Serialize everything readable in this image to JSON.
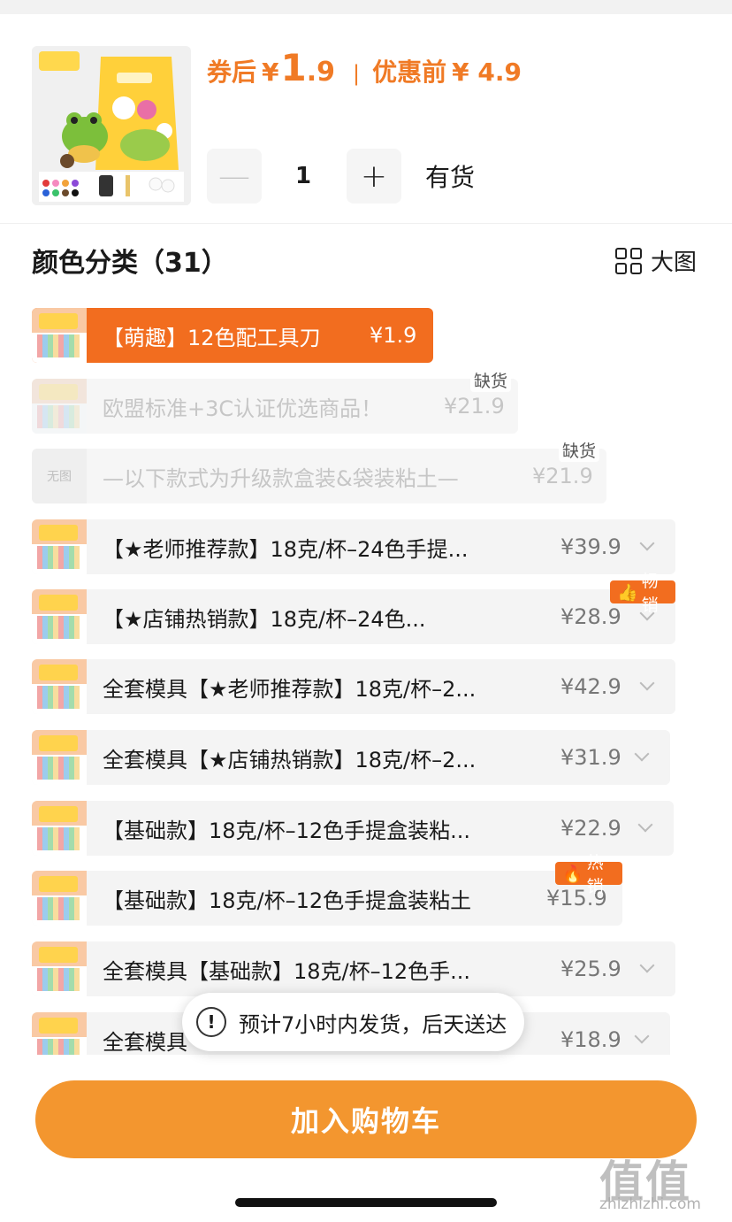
{
  "header": {
    "price_label": "券后",
    "currency": "¥",
    "price_big": "1",
    "price_small": ".9",
    "separator": "|",
    "orig_label": "优惠前",
    "orig_price": "¥ 4.9",
    "qty_minus": "—",
    "qty_plus": "+",
    "quantity": "1",
    "stock_status": "有货"
  },
  "category": {
    "title": "颜色分类（31）",
    "view_toggle": "大图"
  },
  "options": [
    {
      "name": "【萌趣】12色配工具刀",
      "price": "¥1.9",
      "state": "selected"
    },
    {
      "name": "欧盟标准+3C认证优选商品！",
      "price": "¥21.9",
      "state": "out",
      "tag": "缺货"
    },
    {
      "name": "—以下款式为升级款盒装&袋装粘土—",
      "price": "¥21.9",
      "state": "out",
      "tag": "缺货",
      "thumb_text": "无图"
    },
    {
      "name": "【★老师推荐款】18克/杯–24色手提...",
      "price": "¥39.9"
    },
    {
      "name": "【★店铺热销款】18克/杯–24色...",
      "price": "¥28.9",
      "badge": "畅销",
      "badge_icon": "thumbs-up-icon"
    },
    {
      "name": "全套模具【★老师推荐款】18克/杯–2...",
      "price": "¥42.9"
    },
    {
      "name": "全套模具【★店铺热销款】18克/杯–2...",
      "price": "¥31.9"
    },
    {
      "name": "【基础款】18克/杯–12色手提盒装粘...",
      "price": "¥22.9"
    },
    {
      "name": "【基础款】18克/杯–12色手提盒装粘土",
      "price": "¥15.9",
      "badge": "热销",
      "badge_icon": "flame-icon"
    },
    {
      "name": "全套模具【基础款】18克/杯–12色手...",
      "price": "¥25.9"
    },
    {
      "name": "全套模具",
      "price": "¥18.9"
    }
  ],
  "toast": {
    "icon": "!",
    "text": "预计7小时内发货，后天送达"
  },
  "cart_button": "加入购物车",
  "watermark": {
    "logo": "值值值",
    "url": "zhizhizhi.com"
  },
  "colors": {
    "accent": "#f26d1f",
    "price": "#f07a25",
    "cart": "#f3962f"
  }
}
